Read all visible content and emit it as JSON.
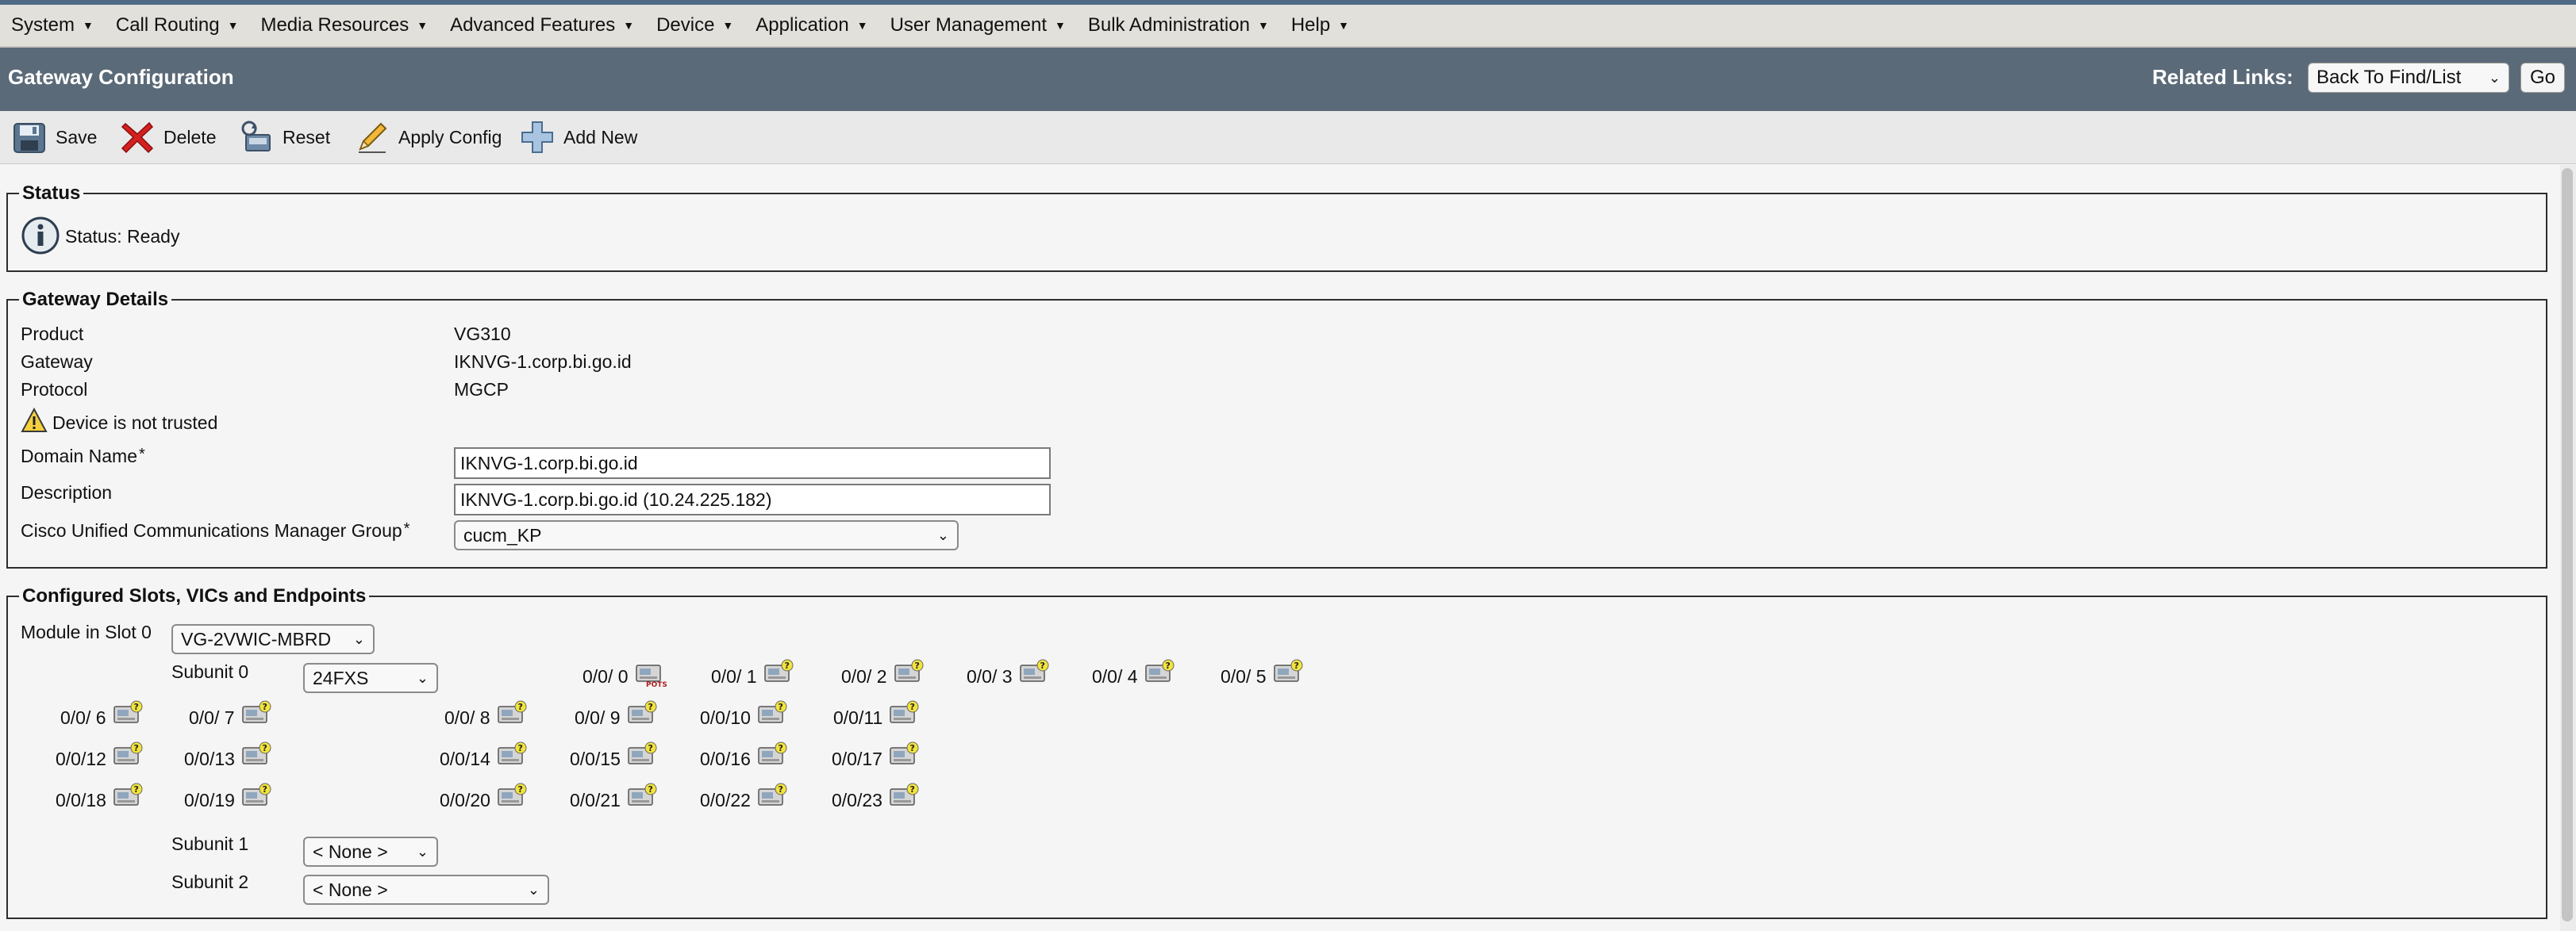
{
  "menu": [
    "System",
    "Call Routing",
    "Media Resources",
    "Advanced Features",
    "Device",
    "Application",
    "User Management",
    "Bulk Administration",
    "Help"
  ],
  "header": {
    "title": "Gateway Configuration",
    "related_label": "Related Links:",
    "related_value": "Back To Find/List",
    "go_label": "Go"
  },
  "toolbar": {
    "save": "Save",
    "delete": "Delete",
    "reset": "Reset",
    "apply_config": "Apply Config",
    "add_new": "Add New"
  },
  "status": {
    "legend": "Status",
    "text": "Status: Ready"
  },
  "gateway_details": {
    "legend": "Gateway Details",
    "product_label": "Product",
    "product_value": "VG310",
    "gateway_label": "Gateway",
    "gateway_value": "IKNVG-1.corp.bi.go.id",
    "protocol_label": "Protocol",
    "protocol_value": "MGCP",
    "trust_warning": "Device is not trusted",
    "domain_label": "Domain Name",
    "domain_value": "IKNVG-1.corp.bi.go.id",
    "description_label": "Description",
    "description_value": "IKNVG-1.corp.bi.go.id (10.24.225.182)",
    "cm_group_label": "Cisco Unified Communications Manager Group",
    "cm_group_value": "cucm_KP",
    "required_mark": "*"
  },
  "slots": {
    "legend": "Configured Slots, VICs and Endpoints",
    "module_label": "Module in Slot 0",
    "module_value": "VG-2VWIC-MBRD",
    "subunit0_label": "Subunit 0",
    "subunit0_value": "24FXS",
    "subunit1_label": "Subunit 1",
    "subunit1_value": "< None >",
    "subunit2_label": "Subunit 2",
    "subunit2_value": "< None >",
    "pots_badge": "POTS",
    "ports": [
      "0/0/ 0",
      "0/0/ 1",
      "0/0/ 2",
      "0/0/ 3",
      "0/0/ 4",
      "0/0/ 5",
      "0/0/ 6",
      "0/0/ 7",
      "0/0/ 8",
      "0/0/ 9",
      "0/0/10",
      "0/0/11",
      "0/0/12",
      "0/0/13",
      "0/0/14",
      "0/0/15",
      "0/0/16",
      "0/0/17",
      "0/0/18",
      "0/0/19",
      "0/0/20",
      "0/0/21",
      "0/0/22",
      "0/0/23"
    ]
  }
}
